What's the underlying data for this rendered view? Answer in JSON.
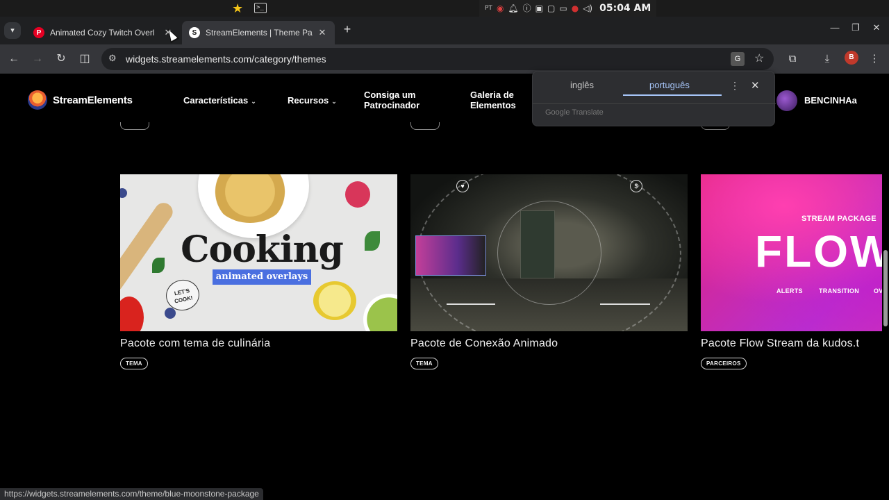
{
  "os": {
    "tray": {
      "lang": "PT",
      "clock": "05:04 AM",
      "icons": [
        "pinned-star-icon",
        "terminal-icon",
        "record-icon",
        "notification-bell-icon",
        "info-icon",
        "clipboard-icon",
        "chat-icon",
        "battery-icon",
        "microphone-icon",
        "volume-icon"
      ]
    }
  },
  "browser": {
    "tabs": [
      {
        "title": "Animated Cozy Twitch Overl",
        "favicon": "pinterest-icon",
        "active": false
      },
      {
        "title": "StreamElements | Theme Pa",
        "favicon": "streamelements-icon",
        "active": true
      }
    ],
    "url": "widgets.streamelements.com/category/themes",
    "profile_initial": "B",
    "status_url": "https://widgets.streamelements.com/theme/blue-moonstone-package"
  },
  "translate_popup": {
    "source_lang": "inglês",
    "target_lang": "português",
    "selected": "português",
    "brand": "Google Translate"
  },
  "site": {
    "logo_text": "StreamElements",
    "nav": [
      {
        "label": "Características",
        "has_dropdown": true
      },
      {
        "label": "Recursos",
        "has_dropdown": true
      },
      {
        "label_line1": "Consiga um",
        "label_line2": "Patrocinador",
        "has_dropdown": false
      },
      {
        "label_line1": "Galeria de",
        "label_line2": "Elementos",
        "has_dropdown": false
      }
    ],
    "username": "BENCINHAa"
  },
  "cards": [
    {
      "title": "Pacote com tema de culinária",
      "tag": "TEMA",
      "thumb": {
        "headline": "Cooking",
        "ribbon": "animated overlays",
        "badge_line1": "LET'S",
        "badge_line2": "COOK!"
      }
    },
    {
      "title": "Pacote de Conexão Animado",
      "tag": "TEMA"
    },
    {
      "title": "Pacote Flow Stream da kudos.t",
      "tag": "PARCEIROS",
      "thumb": {
        "kicker": "STREAM PACKAGE",
        "headline": "FLOW",
        "sub1": "ALERTS",
        "sub2": "TRANSITION",
        "sub3": "OV"
      }
    }
  ],
  "colors": {
    "page_bg": "#000000",
    "accent_translate": "#a8c7fa",
    "ribbon_blue": "#4a6fe0",
    "flow_pink": "#e0247e"
  }
}
